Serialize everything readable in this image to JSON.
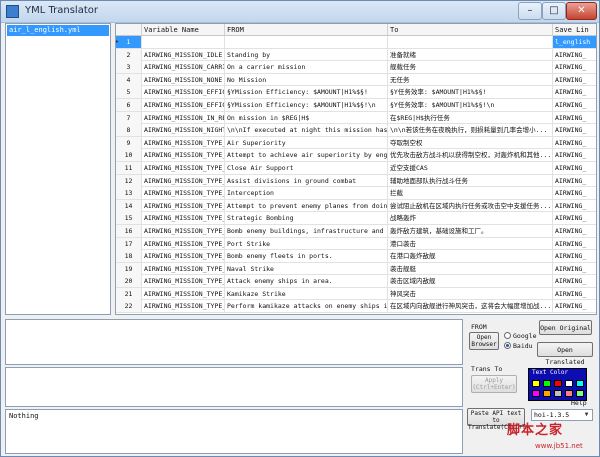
{
  "window": {
    "title": "YML Translator",
    "min": "–",
    "max": "□",
    "close": "✕"
  },
  "file_list": {
    "items": [
      "air_l_english.yml"
    ]
  },
  "table": {
    "columns": [
      "",
      "Variable Name",
      "FROM",
      "To",
      "Save Lin"
    ],
    "rows": [
      {
        "num": "1",
        "var": "",
        "from": "",
        "to": "",
        "save": "l_english"
      },
      {
        "num": "2",
        "var": "AIRWING_MISSION_IDLE",
        "from": "Standing by",
        "to": "准备就绪",
        "save": "AIRWING_"
      },
      {
        "num": "3",
        "var": "AIRWING_MISSION_CARRI...",
        "from": "On a carrier mission",
        "to": "舰载任务",
        "save": "AIRWING_"
      },
      {
        "num": "4",
        "var": "AIRWING_MISSION_NONE",
        "from": "No Mission",
        "to": "无任务",
        "save": "AIRWING_"
      },
      {
        "num": "5",
        "var": "AIRWING_MISSION_EFFIC...",
        "from": "§YMission Efficiency: $AMOUNT|H1%$§!",
        "to": "§Y任务效率: $AMOUNT|H1%$§!",
        "save": "AIRWING_"
      },
      {
        "num": "6",
        "var": "AIRWING_MISSION_EFFIC...",
        "from": "§YMission Efficiency: $AMOUNT|H1%$§!\\n",
        "to": "§Y任务效率: $AMOUNT|H1%$§!\\n",
        "save": "AIRWING_"
      },
      {
        "num": "7",
        "var": "AIRWING_MISSION_IN_RE...",
        "from": "On mission in $REG|H$",
        "to": "在$REG|H$执行任务",
        "save": "AIRWING_"
      },
      {
        "num": "8",
        "var": "AIRWING_MISSION_NIGHT...",
        "from": "\\n\\nIf executed at night this mission has a eu...",
        "to": "\\n\\n若该任务在夜晚执行，则损耗量到几率会增小...",
        "save": "AIRWING_"
      },
      {
        "num": "9",
        "var": "AIRWING_MISSION_TYPE_...",
        "from": "Air Superiority",
        "to": "夺取制空权",
        "save": "AIRWING_"
      },
      {
        "num": "10",
        "var": "AIRWING_MISSION_TYPE_...",
        "from": "Attempt to achieve air superiority by engaging...",
        "to": "优先攻击敌方战斗机以获得制空权，对轰炸机和其他...",
        "save": "AIRWING_"
      },
      {
        "num": "11",
        "var": "AIRWING_MISSION_TYPE_CAS",
        "from": "Close Air Support",
        "to": "近空支援CAS",
        "save": "AIRWING_"
      },
      {
        "num": "12",
        "var": "AIRWING_MISSION_TYPE_...",
        "from": "Assist divisions in ground combat",
        "to": "辅助地面部队执行战斗任务",
        "save": "AIRWING_"
      },
      {
        "num": "13",
        "var": "AIRWING_MISSION_TYPE_...",
        "from": "Interception",
        "to": "拦截",
        "save": "AIRWING_"
      },
      {
        "num": "14",
        "var": "AIRWING_MISSION_TYPE_...",
        "from": "Attempt to prevent enemy planes from doing mi...",
        "to": "尝试阻止敌机在区域内执行任务或攻击空中支援任务...",
        "save": "AIRWING_"
      },
      {
        "num": "15",
        "var": "AIRWING_MISSION_TYPE_...",
        "from": "Strategic Bombing",
        "to": "战略轰炸",
        "save": "AIRWING_"
      },
      {
        "num": "16",
        "var": "AIRWING_MISSION_TYPE_...",
        "from": "Bomb enemy buildings, infrastructure and indus...",
        "to": "轰炸敌方建筑，基础设施和工厂。",
        "save": "AIRWING_"
      },
      {
        "num": "17",
        "var": "AIRWING_MISSION_TYPE_...",
        "from": "Port Strike",
        "to": "港口袭击",
        "save": "AIRWING_"
      },
      {
        "num": "18",
        "var": "AIRWING_MISSION_TYPE_...",
        "from": "Bomb enemy fleets in ports.",
        "to": "在港口轰炸敌舰",
        "save": "AIRWING_"
      },
      {
        "num": "19",
        "var": "AIRWING_MISSION_TYPE_...",
        "from": "Naval Strike",
        "to": "袭击舰艇",
        "save": "AIRWING_"
      },
      {
        "num": "20",
        "var": "AIRWING_MISSION_TYPE_...",
        "from": "Attack enemy ships in area.",
        "to": "袭击区域内敌舰",
        "save": "AIRWING_"
      },
      {
        "num": "21",
        "var": "AIRWING_MISSION_TYPE_...",
        "from": "Kamikaze Strike",
        "to": "神风突击",
        "save": "AIRWING_"
      },
      {
        "num": "22",
        "var": "AIRWING_MISSION_TYPE_...",
        "from": "Perform kamikaze attacks on enemy ships in are...",
        "to": "在区域内向敌舰进行神风突击，这将会大幅度增加战...",
        "save": "AIRWING_"
      }
    ]
  },
  "from_group": {
    "label": "FROM",
    "open_browser": "Open Browser",
    "google": "Google",
    "baidu": "Baidu",
    "selected_engine": "Baidu"
  },
  "buttons": {
    "open_original": "Open Original",
    "open_translated": "Open Translated",
    "apply": "Apply\n(Ctrl+Enter)",
    "paste": "Paste API text to Translate(Ctrl+T)"
  },
  "trans_to": {
    "label": "Trans To"
  },
  "text_color": {
    "label": "Text Color",
    "swatches": [
      "#ffff00",
      "#00ff00",
      "#ff0000",
      "#ffffff",
      "#00ffff",
      "#ff00ff",
      "#ffa500",
      "#c0c0c0",
      "#ff8080",
      "#80ff80"
    ]
  },
  "help": {
    "label": "Help"
  },
  "version": {
    "value": "hoi-1.3.5"
  },
  "status": {
    "text": "Nothing"
  },
  "watermark": {
    "main": "脚本之家",
    "sub": "www.jb51.net"
  }
}
